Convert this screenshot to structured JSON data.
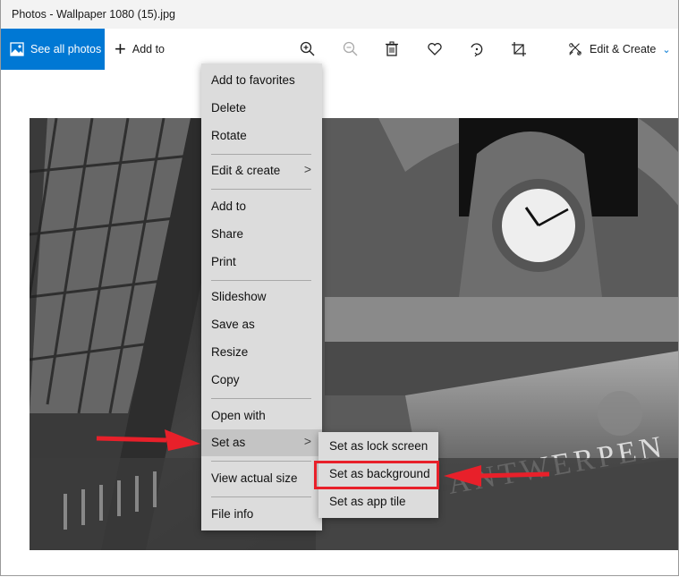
{
  "window": {
    "title": "Photos - Wallpaper 1080 (15).jpg"
  },
  "toolbar": {
    "see_all_photos": "See all photos",
    "add_to": "Add to",
    "icons": [
      "zoom-in-icon",
      "zoom-out-icon",
      "delete-icon",
      "favorite-heart-icon",
      "rotate-icon",
      "crop-icon"
    ],
    "edit_create": "Edit & Create",
    "accent": "#0078d4"
  },
  "context_menu": {
    "items": [
      {
        "label": "Add to favorites"
      },
      {
        "label": "Delete"
      },
      {
        "label": "Rotate"
      },
      {
        "label": "Edit & create",
        "has_submenu": true
      },
      {
        "label": "Add to"
      },
      {
        "label": "Share"
      },
      {
        "label": "Print"
      },
      {
        "label": "Slideshow"
      },
      {
        "label": "Save as"
      },
      {
        "label": "Resize"
      },
      {
        "label": "Copy"
      },
      {
        "label": "Open with"
      },
      {
        "label": "Set as",
        "has_submenu": true,
        "highlighted": true
      },
      {
        "label": "View actual size"
      },
      {
        "label": "File info"
      }
    ],
    "arrow_glyph": ">"
  },
  "submenu": {
    "items": [
      {
        "label": "Set as lock screen"
      },
      {
        "label": "Set as background",
        "annotated": true
      },
      {
        "label": "Set as app tile"
      }
    ]
  },
  "annotation": {
    "color": "#e8202a"
  },
  "photo": {
    "description": "Black and white photo of ornate clock at Antwerpen station",
    "inscription": "ANTWERPEN"
  }
}
